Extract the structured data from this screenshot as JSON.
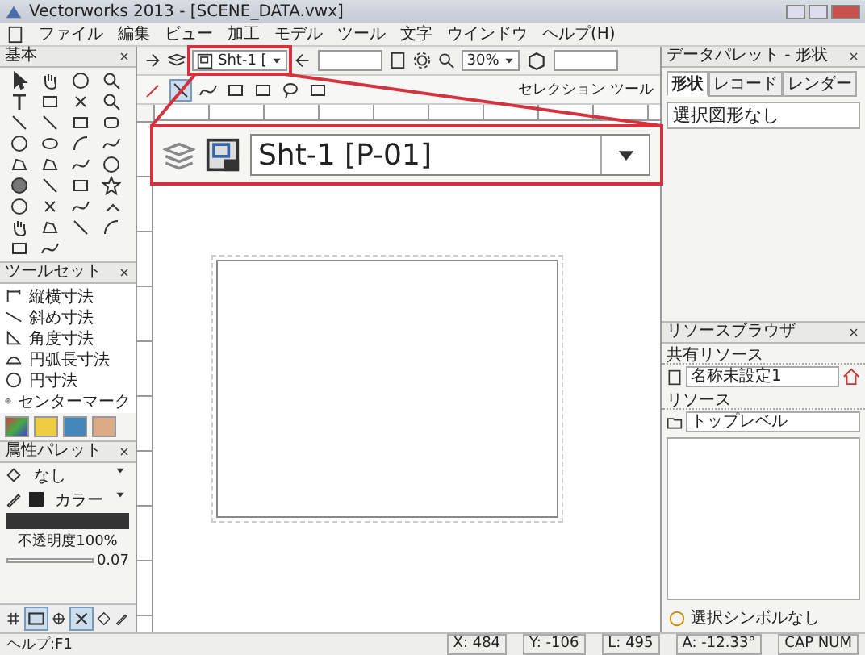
{
  "window": {
    "title": "Vectorworks 2013 - [SCENE_DATA.vwx]"
  },
  "menu": [
    "ファイル",
    "編集",
    "ビュー",
    "加工",
    "モデル",
    "ツール",
    "文字",
    "ウインドウ",
    "ヘルプ(H)"
  ],
  "view_bar": {
    "sheet": "Sht-1 [",
    "zoom": "30%"
  },
  "mode_bar": {
    "label": "セレクション ツール"
  },
  "tool_palette": {
    "title": "基本"
  },
  "tool_set": {
    "title": "ツールセット",
    "items": [
      "縦横寸法",
      "斜め寸法",
      "角度寸法",
      "円弧長寸法",
      "円寸法",
      "センターマーク"
    ]
  },
  "attributes": {
    "title": "属性パレット",
    "fill": "なし",
    "pen": "カラー",
    "opacity": "不透明度100%",
    "thickness": "0.07"
  },
  "data_palette": {
    "title": "データパレット - 形状",
    "tabs": [
      {
        "label": "形状",
        "selected": true
      },
      {
        "label": "レコード",
        "selected": false
      },
      {
        "label": "レンダー",
        "selected": false
      }
    ],
    "message": "選択図形なし"
  },
  "resource_browser": {
    "title": "リソースブラウザ",
    "shared_label": "共有リソース",
    "shared_file": "名称未設定1",
    "resources_label": "リソース",
    "folder": "トップレベル",
    "footer": "選択シンボルなし"
  },
  "status_bar": {
    "help": "ヘルプ:F1",
    "x": "X: 484",
    "y": "Y: -106",
    "l": "L: 495",
    "a": "A: -12.33°",
    "keys": "CAP NUM"
  },
  "callout": {
    "sheet": "Sht-1 [P-01]"
  }
}
